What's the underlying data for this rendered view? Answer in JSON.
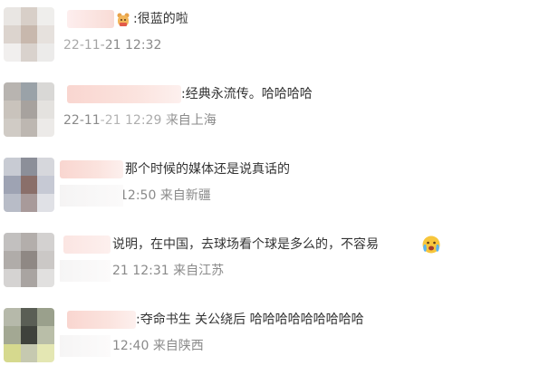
{
  "comments": [
    {
      "text": ":很蓝的啦",
      "date": "22-11-21",
      "time": "12:32",
      "location": ""
    },
    {
      "text": ":经典永流传。哈哈哈哈",
      "date": "22-11-21",
      "time": "12:29",
      "location": "来自上海"
    },
    {
      "text": "那个时候的媒体还是说真话的",
      "date": "",
      "time": "12:50",
      "location": "来自新疆"
    },
    {
      "text": "说明，在中国，去球场看个球是多么的，不容易",
      "date": "21",
      "time": "12:31",
      "location": "来自江苏"
    },
    {
      "text": ":夺命书生 关公绕后 哈哈哈哈哈哈哈哈哈",
      "date": "",
      "time": "12:40",
      "location": "来自陕西"
    }
  ],
  "icons": {
    "comment_0_emoji": "bear-emoji-icon",
    "comment_3_emoji": "crying-face-emoji-icon"
  }
}
